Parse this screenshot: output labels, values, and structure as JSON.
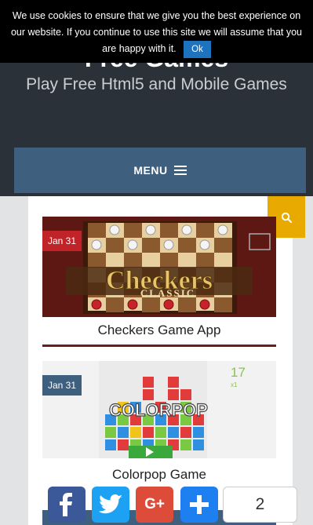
{
  "cookie_notice": {
    "text": "We use cookies to ensure that we give you the best experience on our website. If you continue to use this site we will assume that you are happy with it.",
    "ok_label": "Ok"
  },
  "header": {
    "site_title": "Free Games",
    "tagline": "Play Free Html5 and Mobile Games"
  },
  "nav": {
    "menu_label": "MENU",
    "menu_icon": "hamburger-icon",
    "search_icon": "search-icon"
  },
  "posts": [
    {
      "date": "Jan 31",
      "title": "Checkers Game App",
      "image_logo": "Checkers",
      "image_logo_sub": "CLASSIC",
      "badge_color": "#c02428"
    },
    {
      "date": "Jan 31",
      "title": "Colorpop Game",
      "image_logo": "COLORPOP",
      "image_score": "17",
      "image_multiplier": "x1",
      "badge_color": "#3e5f7e"
    }
  ],
  "share_bar": {
    "buttons": [
      "facebook-icon",
      "twitter-icon",
      "google-plus-icon",
      "plus-icon"
    ],
    "count": "2"
  },
  "colors": {
    "header_bg": "#2b3138",
    "menu_bg": "#3e5f7e",
    "search_bg": "#e8a900",
    "accent_blue": "#1e73be"
  }
}
